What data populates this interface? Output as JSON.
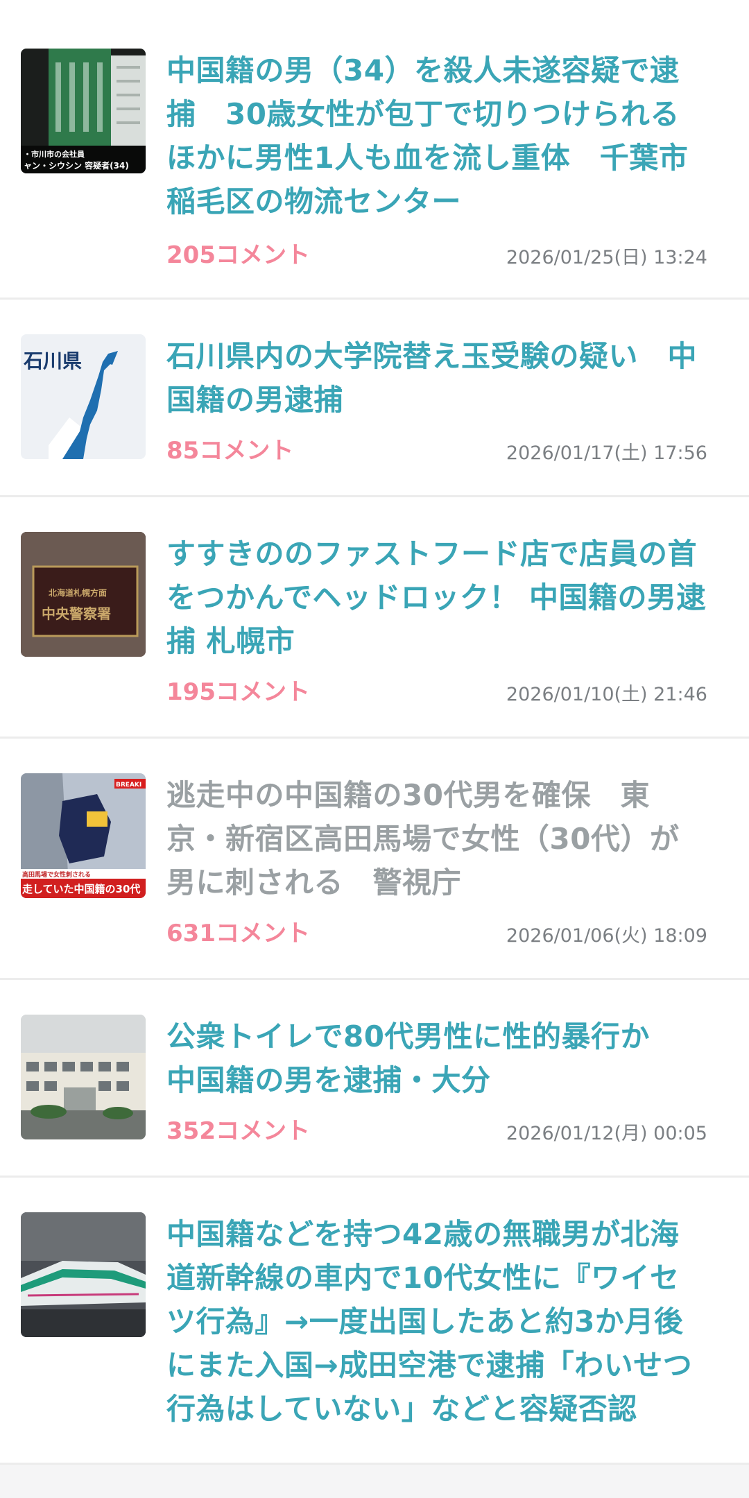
{
  "articles": [
    {
      "title": "中国籍の男（34）を殺人未遂容疑で逮捕　30歳女性が包丁で切りつけられる　ほかに男性1人も血を流し重体　千葉市稲毛区の物流センター",
      "comments": "205コメント",
      "datetime": "2026/01/25(日) 13:24",
      "visited": false,
      "thumbnail": {
        "icon": "building-at-night-thumbnail",
        "caption_line1": "・市川市の会社員",
        "caption_line2": "ャン・シウシン 容疑者(34)"
      }
    },
    {
      "title": "石川県内の大学院替え玉受験の疑い　中国籍の男逮捕",
      "comments": "85コメント",
      "datetime": "2026/01/17(土) 17:56",
      "visited": false,
      "thumbnail": {
        "icon": "ishikawa-map-thumbnail",
        "caption_line1": "石川県"
      }
    },
    {
      "title": "すすきののファストフード店で店員の首をつかんでヘッドロック！ 中国籍の男逮捕 札幌市",
      "comments": "195コメント",
      "datetime": "2026/01/10(土) 21:46",
      "visited": false,
      "thumbnail": {
        "icon": "police-station-sign-thumbnail",
        "caption_line1": "北海道札幌方面",
        "caption_line2": "中央警察署"
      }
    },
    {
      "title": "逃走中の中国籍の30代男を確保　東京・新宿区高田馬場で女性（30代）が男に刺される　警視庁",
      "comments": "631コメント",
      "datetime": "2026/01/06(火) 18:09",
      "visited": true,
      "thumbnail": {
        "icon": "police-investigation-thumbnail",
        "caption_line1": "BREAKI",
        "caption_line2": "高田馬場で女性刺される",
        "caption_line3": "走していた中国籍の30代"
      }
    },
    {
      "title": "公衆トイレで80代男性に性的暴行か　中国籍の男を逮捕・大分",
      "comments": "352コメント",
      "datetime": "2026/01/12(月) 00:05",
      "visited": false,
      "thumbnail": {
        "icon": "police-building-thumbnail"
      }
    },
    {
      "title": "中国籍などを持つ42歳の無職男が北海道新幹線の車内で10代女性に『ワイセツ行為』→一度出国したあと約3か月後にまた入国→成田空港で逮捕「わいせつ行為はしていない」などと容疑否認",
      "comments": "",
      "datetime": "",
      "visited": false,
      "thumbnail": {
        "icon": "shinkansen-train-thumbnail"
      }
    }
  ],
  "colors": {
    "title": "#3aa5b6",
    "title_visited": "#9aa0a3",
    "comments": "#f4869a",
    "timestamp": "#7b7f83"
  }
}
